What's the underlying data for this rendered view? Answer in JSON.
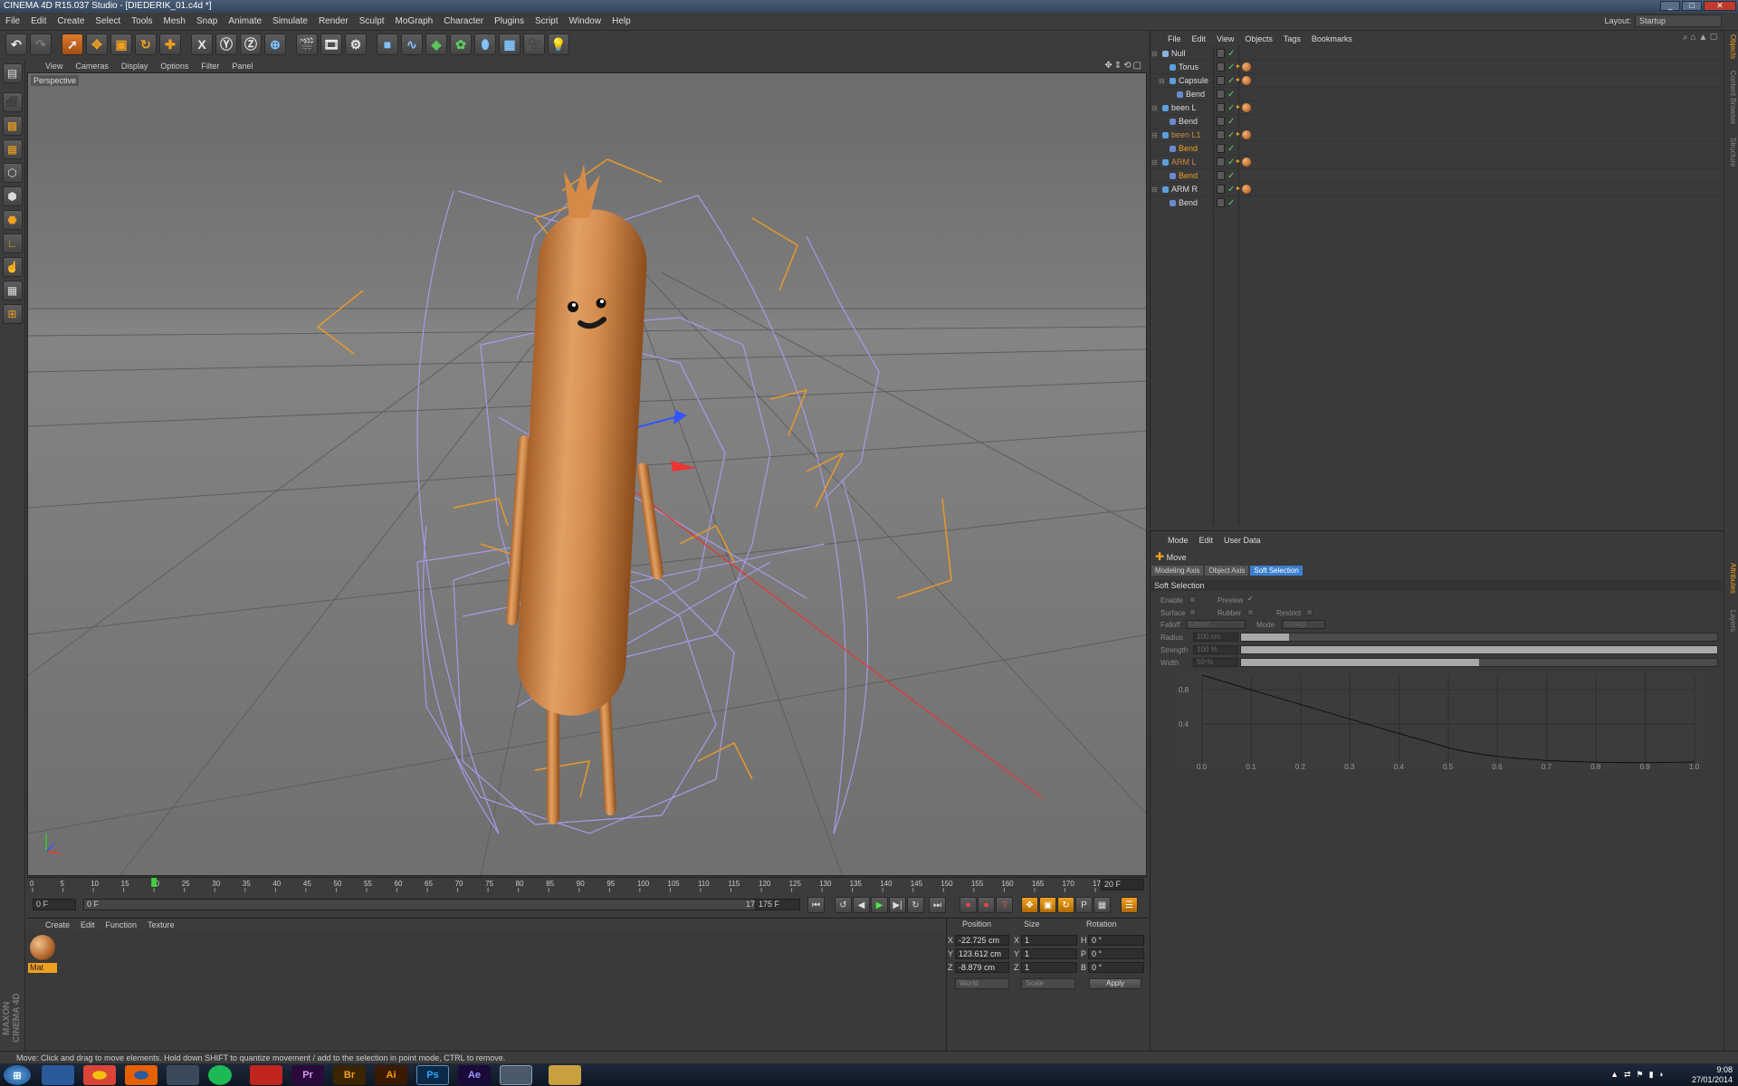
{
  "window": {
    "title": "CINEMA 4D R15.037 Studio - [DIEDERIK_01.c4d *]"
  },
  "menu": [
    "File",
    "Edit",
    "Create",
    "Select",
    "Tools",
    "Mesh",
    "Snap",
    "Animate",
    "Simulate",
    "Render",
    "Sculpt",
    "MoGraph",
    "Character",
    "Plugins",
    "Script",
    "Window",
    "Help"
  ],
  "layout": {
    "label": "Layout:",
    "value": "Startup"
  },
  "viewport": {
    "menu": [
      "View",
      "Cameras",
      "Display",
      "Options",
      "Filter",
      "Panel"
    ],
    "label": "Perspective"
  },
  "timeline": {
    "ticks": [
      "0",
      "5",
      "10",
      "15",
      "20",
      "25",
      "30",
      "35",
      "40",
      "45",
      "50",
      "55",
      "60",
      "65",
      "70",
      "75",
      "80",
      "85",
      "90",
      "95",
      "100",
      "105",
      "110",
      "115",
      "120",
      "125",
      "130",
      "135",
      "140",
      "145",
      "150",
      "155",
      "160",
      "165",
      "170",
      "175"
    ],
    "current_marker": "20",
    "frame_indicator": "20 F"
  },
  "transport": {
    "start": "0 F",
    "slider_start": "0 F",
    "slider_end": "175 F",
    "end": "175 F"
  },
  "materials": {
    "menu": [
      "Create",
      "Edit",
      "Function",
      "Texture"
    ],
    "items": [
      {
        "name": "Mat"
      }
    ]
  },
  "coordinates": {
    "headers": {
      "position": "Position",
      "size": "Size",
      "rotation": "Rotation"
    },
    "rows": [
      {
        "axis": "X",
        "pos": "-22.725 cm",
        "size_axis": "X",
        "size": "1",
        "rot_axis": "H",
        "rot": "0 °"
      },
      {
        "axis": "Y",
        "pos": "123.612 cm",
        "size_axis": "Y",
        "size": "1",
        "rot_axis": "P",
        "rot": "0 °"
      },
      {
        "axis": "Z",
        "pos": "-8.879 cm",
        "size_axis": "Z",
        "size": "1",
        "rot_axis": "B",
        "rot": "0 °"
      }
    ],
    "mode": "World",
    "scale": "Scale",
    "apply": "Apply"
  },
  "status": "Move: Click and drag to move elements. Hold down SHIFT to quantize movement / add to the selection in point mode, CTRL to remove.",
  "objects": {
    "menu": [
      "File",
      "Edit",
      "View",
      "Objects",
      "Tags",
      "Bookmarks"
    ],
    "rows": [
      {
        "name": "Null",
        "depth": 0,
        "color": "#dddddd",
        "icon": "#8ab4e0",
        "mat": false
      },
      {
        "name": "Torus",
        "depth": 1,
        "color": "#dddddd",
        "icon": "#5aa0e0",
        "mat": true
      },
      {
        "name": "Capsule",
        "depth": 1,
        "color": "#dddddd",
        "icon": "#5aa0e0",
        "mat": true
      },
      {
        "name": "Bend",
        "depth": 2,
        "color": "#dddddd",
        "icon": "#6a8ad0",
        "mat": false
      },
      {
        "name": "been L",
        "depth": 0,
        "color": "#dddddd",
        "icon": "#5aa0e0",
        "mat": true
      },
      {
        "name": "Bend",
        "depth": 1,
        "color": "#dddddd",
        "icon": "#6a8ad0",
        "mat": false
      },
      {
        "name": "been L1",
        "depth": 0,
        "color": "#c98a3a",
        "icon": "#5aa0e0",
        "mat": true
      },
      {
        "name": "Bend",
        "depth": 1,
        "color": "#f0a020",
        "icon": "#6a8ad0",
        "mat": false
      },
      {
        "name": "ARM L",
        "depth": 0,
        "color": "#c98a3a",
        "icon": "#5aa0e0",
        "mat": true
      },
      {
        "name": "Bend",
        "depth": 1,
        "color": "#f0a020",
        "icon": "#6a8ad0",
        "mat": false
      },
      {
        "name": "ARM R",
        "depth": 0,
        "color": "#dddddd",
        "icon": "#5aa0e0",
        "mat": true
      },
      {
        "name": "Bend",
        "depth": 1,
        "color": "#dddddd",
        "icon": "#6a8ad0",
        "mat": false
      }
    ]
  },
  "attributes": {
    "menu": [
      "Mode",
      "Edit",
      "User Data"
    ],
    "title": "Move",
    "tabs": [
      "Modeling Axis",
      "Object Axis",
      "Soft Selection"
    ],
    "active_tab": "Soft Selection",
    "section": "Soft Selection",
    "labels": {
      "enable": "Enable",
      "preview": "Preview",
      "surface": "Surface",
      "rubber": "Rubber",
      "restrict": "Restrict",
      "falloff": "Falloff",
      "falloff_val": "Linear",
      "mode": "Mode",
      "mode_val": "Group",
      "radius": "Radius",
      "radius_val": "100 cm",
      "strength": "Strength",
      "strength_val": "100 %",
      "width": "Width",
      "width_val": "50 %"
    },
    "levels": {
      "radius": 0.1,
      "strength": 1.0,
      "width": 0.5
    },
    "graph": {
      "x_ticks": [
        "0.0",
        "0.1",
        "0.2",
        "0.3",
        "0.4",
        "0.5",
        "0.6",
        "0.7",
        "0.8",
        "0.9",
        "1.0"
      ],
      "y_ticks": [
        "0.8",
        "0.4"
      ]
    }
  },
  "side_tabs": [
    "Objects",
    "Content Browser",
    "Structure",
    "Attributes",
    "Layers"
  ],
  "taskbar": {
    "apps": [
      "",
      "",
      "",
      "",
      "",
      "",
      "",
      "Pr",
      "Br",
      "Ai",
      "Ps",
      "Ae",
      "",
      ""
    ],
    "time": "9:08",
    "date": "27/01/2014"
  }
}
